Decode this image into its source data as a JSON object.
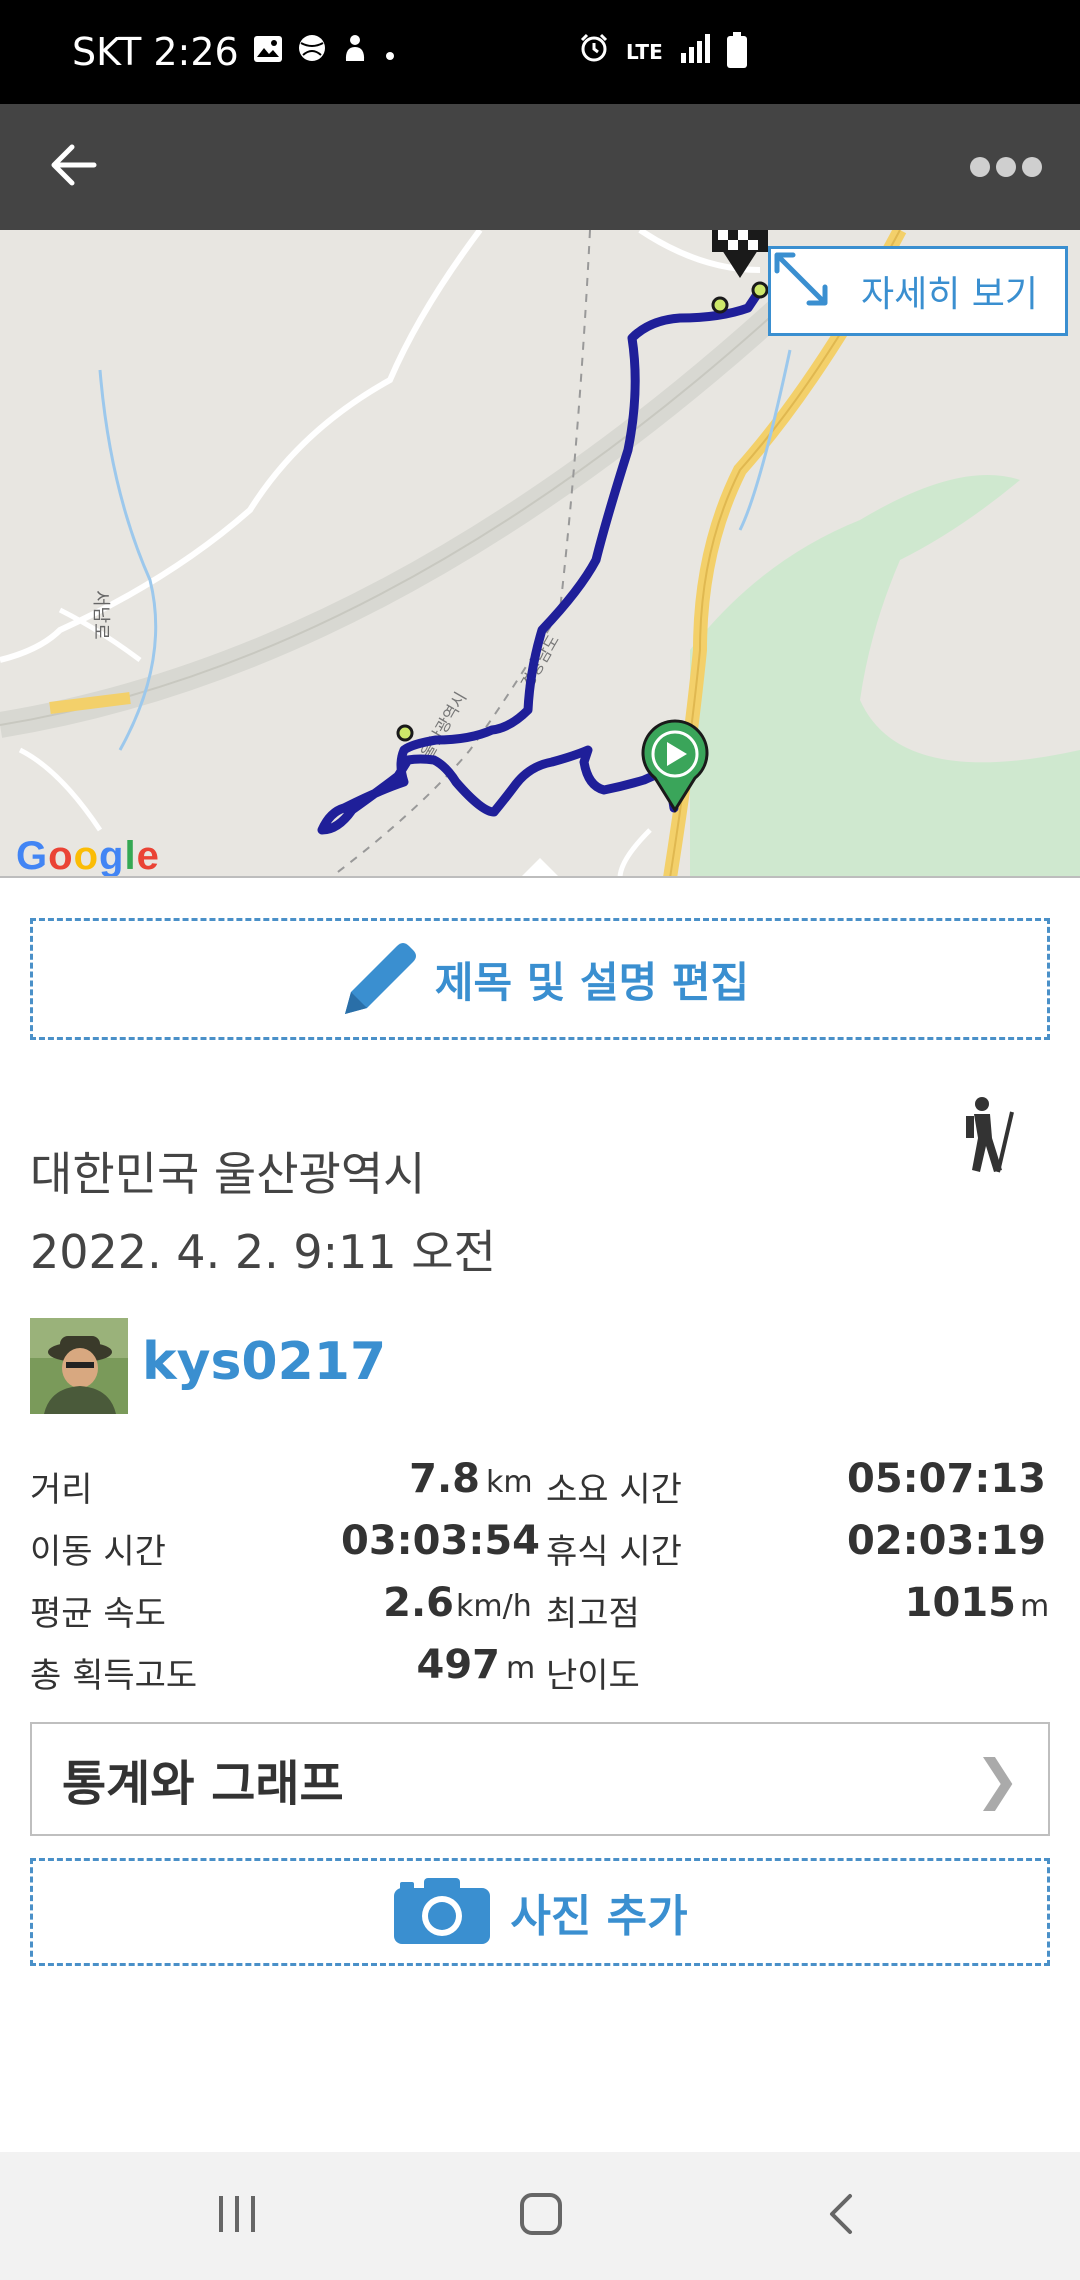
{
  "status_bar": {
    "carrier_time": "SKT 2:26",
    "icons": [
      "image-icon",
      "ball-icon",
      "hand-icon",
      "dot-icon"
    ],
    "right_icons": [
      "alarm-icon",
      "lte-icon",
      "signal-icon",
      "battery-icon"
    ],
    "lte_label": "LTE"
  },
  "app_bar": {
    "back_icon": "arrow-left-icon",
    "more_icon": "more-horizontal-icon"
  },
  "map": {
    "detail_button_label": "자세히 보기",
    "google_logo": "Google",
    "labels": [
      "울산광역시",
      "경상남도",
      "서남로"
    ],
    "route_color": "#1f1f99"
  },
  "edit": {
    "label": "제목 및 설명 편집"
  },
  "trip": {
    "location": "대한민국 울산광역시",
    "datetime": "2022. 4. 2. 9:11 오전",
    "activity_icon": "hiking-icon",
    "username": "kys0217"
  },
  "stats": {
    "distance_label": "거리",
    "distance_value": "7.8",
    "distance_unit": "km",
    "total_time_label": "소요 시간",
    "total_time_value": "05:07:13",
    "moving_time_label": "이동 시간",
    "moving_time_value": "03:03:54",
    "rest_time_label": "휴식 시간",
    "rest_time_value": "02:03:19",
    "avg_speed_label": "평균 속도",
    "avg_speed_value": "2.6",
    "avg_speed_unit": "km/h",
    "max_alt_label": "최고점",
    "max_alt_value": "1015",
    "max_alt_unit": "m",
    "total_ascent_label": "총 획득고도",
    "total_ascent_value": "497",
    "total_ascent_unit": "m",
    "difficulty_label": "난이도"
  },
  "graph": {
    "label": "통계와 그래프",
    "chevron": "❯"
  },
  "photo": {
    "label": "사진 추가"
  },
  "nav": {
    "recent_icon": "recent-apps-icon",
    "home_icon": "home-icon",
    "back_icon": "back-nav-icon"
  },
  "colors": {
    "accent": "#3a8fd0",
    "app_bar": "#444444",
    "route": "#1f1f99"
  }
}
